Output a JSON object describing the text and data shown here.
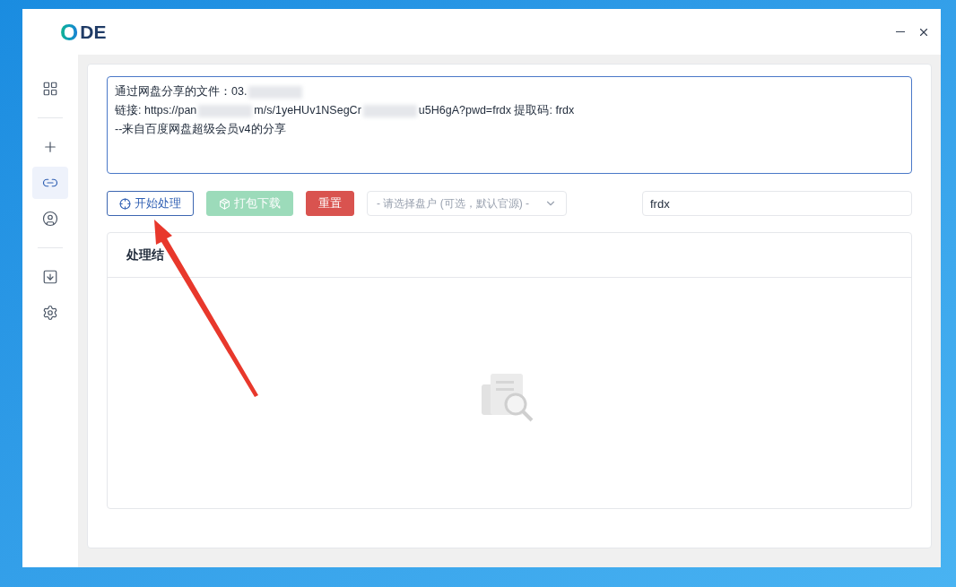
{
  "app": {
    "logo_mark": "O",
    "logo_text": "DE"
  },
  "window_controls": [
    {
      "kind": "minimize"
    },
    {
      "kind": "close"
    }
  ],
  "sidebar": {
    "items": [
      {
        "kind": "grid",
        "selected": false
      },
      {
        "kind": "divider"
      },
      {
        "kind": "plus",
        "selected": false
      },
      {
        "kind": "link",
        "selected": true
      },
      {
        "kind": "user",
        "selected": false
      },
      {
        "kind": "divider"
      },
      {
        "kind": "download",
        "selected": false
      },
      {
        "kind": "settings",
        "selected": false
      }
    ]
  },
  "share_text": {
    "lines": [
      [
        {
          "kind": "text",
          "text": "通过网盘分享的文件：03."
        },
        {
          "kind": "redacted"
        }
      ],
      [
        {
          "kind": "text",
          "text": "链接: https://pan"
        },
        {
          "kind": "redacted"
        },
        {
          "kind": "text",
          "text": "m/s/1yeHUv1NSegCr"
        },
        {
          "kind": "redacted"
        },
        {
          "kind": "text",
          "text": "u5H6gA?pwd=frdx 提取码: frdx"
        }
      ],
      [
        {
          "kind": "text",
          "text": "--来自百度网盘超级会员v4的分享"
        }
      ]
    ]
  },
  "actions": [
    {
      "kind": "outline",
      "label": "开始处理",
      "disabled": false
    },
    {
      "kind": "success",
      "label": "打包下载",
      "disabled": true
    },
    {
      "kind": "danger",
      "label": "重置",
      "disabled": false
    }
  ],
  "drive_select": {
    "placeholder": "- 请选择盘户 (可选，默认官源) -"
  },
  "code_field": {
    "value": "frdx"
  },
  "result_panel": {
    "title": "处理结"
  }
}
